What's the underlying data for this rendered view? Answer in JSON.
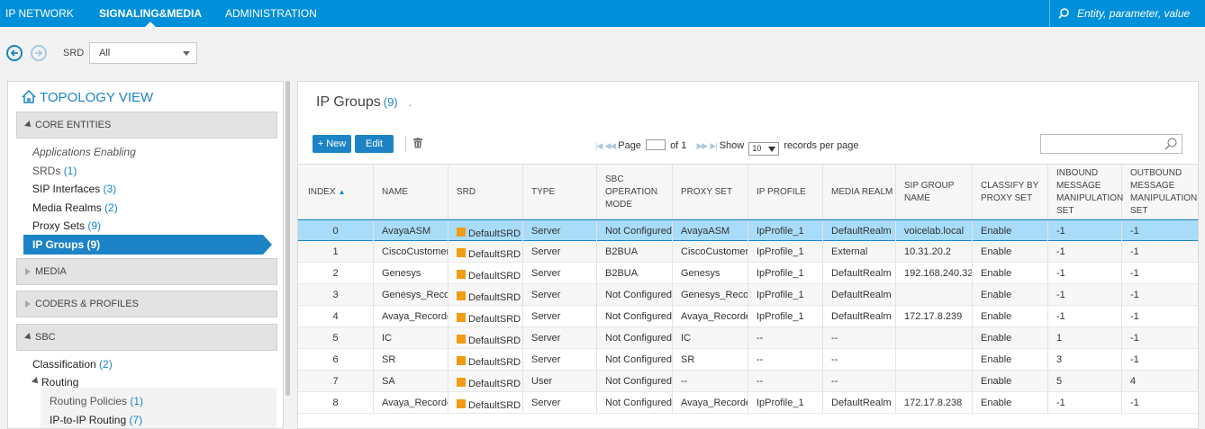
{
  "topnav": {
    "items": [
      "IP NETWORK",
      "SIGNALING&MEDIA",
      "ADMINISTRATION"
    ],
    "active": "SIGNALING&MEDIA",
    "search_placeholder": "Entity, parameter, value"
  },
  "srd": {
    "label": "SRD",
    "value": "All"
  },
  "topology": {
    "title": "TOPOLOGY VIEW",
    "sections": {
      "core": "CORE ENTITIES",
      "media": "MEDIA",
      "coders": "CODERS & PROFILES",
      "sbc": "SBC"
    },
    "core_items": [
      {
        "label": "Applications Enabling",
        "count": ""
      },
      {
        "label": "SRDs",
        "count": "(1)"
      },
      {
        "label": "SIP Interfaces",
        "count": "(3)"
      },
      {
        "label": "Media Realms",
        "count": "(2)"
      },
      {
        "label": "Proxy Sets",
        "count": "(9)"
      }
    ],
    "active_item": "IP Groups (9)",
    "sbc_items": [
      {
        "label": "Classification",
        "count": "(2)"
      },
      {
        "label": "Routing",
        "count": ""
      },
      {
        "label": "Routing Policies",
        "count": "(1)"
      },
      {
        "label": "IP-to-IP Routing",
        "count": "(7)"
      }
    ]
  },
  "main": {
    "title": "IP Groups",
    "count": "(9)",
    "dot": ".",
    "new_label": "+ New",
    "edit_label": "Edit",
    "pager": {
      "page_label": "Page",
      "of_label": "of 1",
      "show_label": "Show",
      "per_page": "10",
      "records_label": "records per page"
    },
    "columns": [
      "INDEX",
      "NAME",
      "SRD",
      "TYPE",
      "SBC OPERATION MODE",
      "PROXY SET",
      "IP PROFILE",
      "MEDIA REALM",
      "SIP GROUP NAME",
      "CLASSIFY BY PROXY SET",
      "INBOUND MESSAGE MANIPULATION SET",
      "OUTBOUND MESSAGE MANIPULATION SET"
    ],
    "rows": [
      [
        "0",
        "AvayaASM",
        "DefaultSRD",
        "Server",
        "Not Configured",
        "AvayaASM",
        "IpProfile_1",
        "DefaultRealm",
        "voicelab.local",
        "Enable",
        "-1",
        "-1"
      ],
      [
        "1",
        "CiscoCustomer",
        "DefaultSRD",
        "Server",
        "B2BUA",
        "CiscoCustomer",
        "IpProfile_1",
        "External",
        "10.31.20.2",
        "Enable",
        "-1",
        "-1"
      ],
      [
        "2",
        "Genesys",
        "DefaultSRD",
        "Server",
        "B2BUA",
        "Genesys",
        "IpProfile_1",
        "DefaultRealm",
        "192.168.240.32",
        "Enable",
        "-1",
        "-1"
      ],
      [
        "3",
        "Genesys_Recor",
        "DefaultSRD",
        "Server",
        "Not Configured",
        "Genesys_Recor",
        "IpProfile_1",
        "DefaultRealm",
        "",
        "Enable",
        "-1",
        "-1"
      ],
      [
        "4",
        "Avaya_Recorde",
        "DefaultSRD",
        "Server",
        "Not Configured",
        "Avaya_Recorde",
        "IpProfile_1",
        "DefaultRealm",
        "172.17.8.239",
        "Enable",
        "-1",
        "-1"
      ],
      [
        "5",
        "IC",
        "DefaultSRD",
        "Server",
        "Not Configured",
        "IC",
        "--",
        "--",
        "",
        "Enable",
        "1",
        "-1"
      ],
      [
        "6",
        "SR",
        "DefaultSRD",
        "Server",
        "Not Configured",
        "SR",
        "--",
        "--",
        "",
        "Enable",
        "3",
        "-1"
      ],
      [
        "7",
        "SA",
        "DefaultSRD",
        "User",
        "Not Configured",
        "--",
        "--",
        "--",
        "",
        "Enable",
        "5",
        "4"
      ],
      [
        "8",
        "Avaya_Recorde",
        "DefaultSRD",
        "Server",
        "Not Configured",
        "Avaya_Recorde",
        "IpProfile_1",
        "DefaultRealm",
        "172.17.8.238",
        "Enable",
        "-1",
        "-1"
      ]
    ],
    "selected_row": 0
  },
  "colors": {
    "brand": "#0090d9",
    "accent": "#1c84c6",
    "selected_row": "#a8dcf8",
    "srd_marker": "#f39b13"
  }
}
